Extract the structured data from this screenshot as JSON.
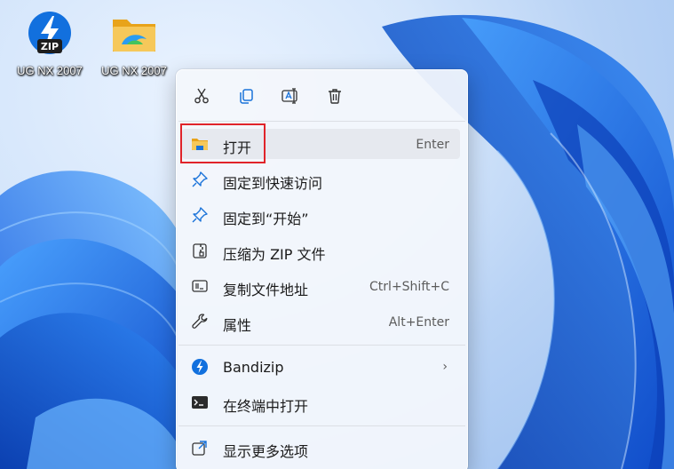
{
  "desktop": {
    "icons": [
      {
        "label": "UG NX 2007",
        "icon": "bandizip-zip-icon"
      },
      {
        "label": "UG NX 2007",
        "icon": "folder-icon"
      }
    ]
  },
  "context_menu": {
    "toolbar": [
      {
        "icon": "cut-icon"
      },
      {
        "icon": "copy-icon"
      },
      {
        "icon": "rename-icon"
      },
      {
        "icon": "delete-icon"
      }
    ],
    "items": [
      {
        "label": "打开",
        "shortcut": "Enter",
        "icon": "folder-icon",
        "highlighted": true
      },
      {
        "label": "固定到快速访问",
        "shortcut": "",
        "icon": "pin-icon"
      },
      {
        "label": "固定到“开始”",
        "shortcut": "",
        "icon": "pin-icon"
      },
      {
        "label": "压缩为 ZIP 文件",
        "shortcut": "",
        "icon": "zip-icon"
      },
      {
        "label": "复制文件地址",
        "shortcut": "Ctrl+Shift+C",
        "icon": "copy-path-icon"
      },
      {
        "label": "属性",
        "shortcut": "Alt+Enter",
        "icon": "wrench-icon"
      },
      {
        "label": "Bandizip",
        "shortcut": "",
        "icon": "bandizip-icon",
        "submenu": true
      },
      {
        "label": "在终端中打开",
        "shortcut": "",
        "icon": "terminal-icon"
      },
      {
        "label": "显示更多选项",
        "shortcut": "",
        "icon": "show-more-icon"
      }
    ],
    "submenu_glyph": "›"
  },
  "colors": {
    "accent": "#0f6cbd",
    "highlight_border": "#e0242a",
    "wallpaper_blue": "#1f6be0"
  }
}
